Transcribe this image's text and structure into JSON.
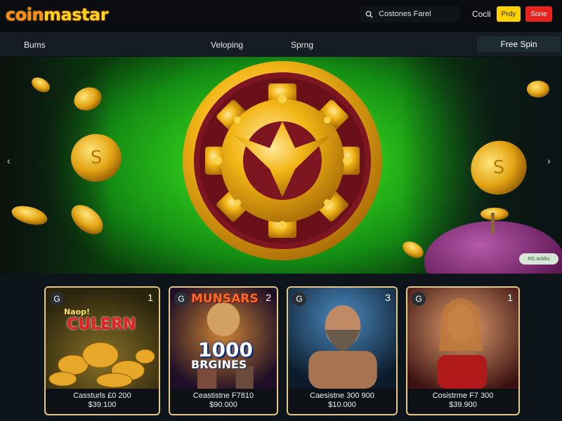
{
  "header": {
    "logo_part1": "coin",
    "logo_part2": "mastar",
    "search_placeholder": "Costones Farel",
    "login_label": "Cocli",
    "play_label": "Prdy",
    "signup_label": "Sone",
    "colors": {
      "accent_yellow": "#ffd200",
      "accent_red": "#e8231d"
    }
  },
  "nav": {
    "items": [
      {
        "label": "Bums"
      },
      {
        "label": "Veloping"
      },
      {
        "label": "Sprng"
      }
    ],
    "cta_label": "Free Spin"
  },
  "hero": {
    "prev_arrow": "‹",
    "next_arrow": "›",
    "badge": "RG Arblks",
    "colors": {
      "glow": "#3fe02a",
      "emblem_gold": "#f2b616",
      "emblem_red": "#7d1621"
    }
  },
  "cards": [
    {
      "badge": "G",
      "rank": "1",
      "art_title_top": "Naop!",
      "art_title": "CULERN",
      "line1": "Cassturls £0 200",
      "line2": "$39.100"
    },
    {
      "badge": "G",
      "rank": "2",
      "art_title_top": "MUNSARS",
      "art_title": "1000",
      "art_subtitle": "BRGINES",
      "line1": "Ceastistne F7810",
      "line2": "$90.000"
    },
    {
      "badge": "G",
      "rank": "3",
      "line1": "Caesistne 300 900",
      "line2": "$10.000"
    },
    {
      "badge": "G",
      "rank": "1",
      "line1": "Cosistrme F7 300",
      "line2": "$39.900"
    }
  ]
}
